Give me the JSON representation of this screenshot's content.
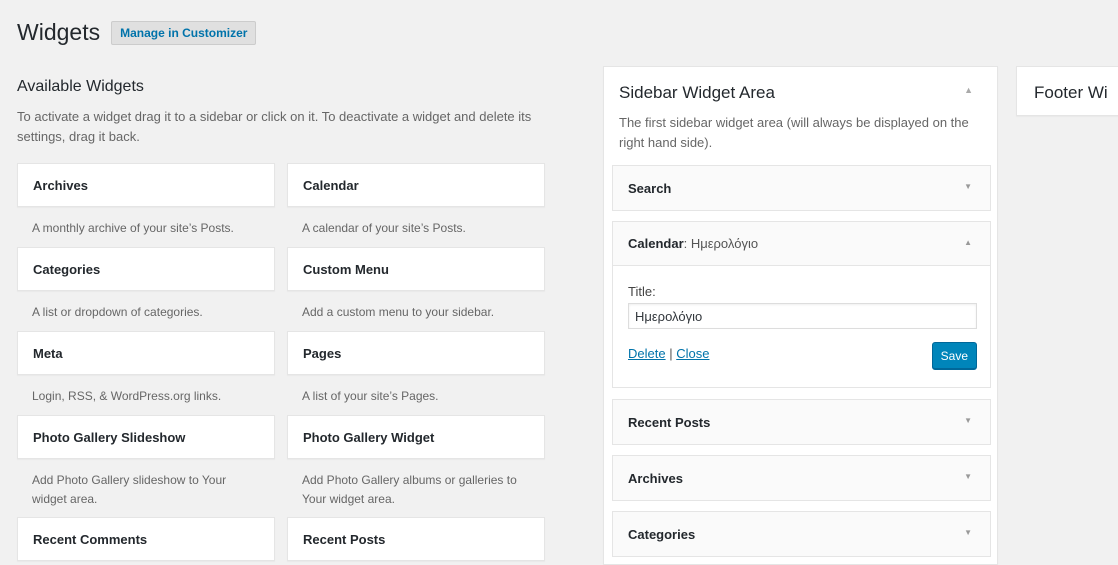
{
  "header": {
    "title": "Widgets",
    "customizer_label": "Manage in Customizer"
  },
  "available": {
    "heading": "Available Widgets",
    "description": "To activate a widget drag it to a sidebar or click on it. To deactivate a widget and delete its settings, drag it back.",
    "widgets": [
      {
        "title": "Archives",
        "desc": "A monthly archive of your site’s Posts."
      },
      {
        "title": "Calendar",
        "desc": "A calendar of your site’s Posts."
      },
      {
        "title": "Categories",
        "desc": "A list or dropdown of categories."
      },
      {
        "title": "Custom Menu",
        "desc": "Add a custom menu to your sidebar."
      },
      {
        "title": "Meta",
        "desc": "Login, RSS, & WordPress.org links."
      },
      {
        "title": "Pages",
        "desc": "A list of your site’s Pages."
      },
      {
        "title": "Photo Gallery Slideshow",
        "desc": "Add Photo Gallery slideshow to Your widget area."
      },
      {
        "title": "Photo Gallery Widget",
        "desc": "Add Photo Gallery albums or galleries to Your widget area."
      },
      {
        "title": "Recent Comments",
        "desc": ""
      },
      {
        "title": "Recent Posts",
        "desc": ""
      }
    ]
  },
  "sidebar": {
    "heading": "Sidebar Widget Area",
    "description": "The first sidebar widget area (will always be displayed on the right hand side).",
    "toggle_icon": "arrow-up-icon",
    "widgets": {
      "search": {
        "title": "Search"
      },
      "calendar": {
        "title": "Calendar",
        "instance_title": ": Ημερολόγιο",
        "field_label": "Title:",
        "field_value": "Ημερολόγιο",
        "delete_label": "Delete",
        "separator": "|",
        "close_label": "Close",
        "save_label": "Save"
      },
      "recent_posts": {
        "title": "Recent Posts"
      },
      "archives": {
        "title": "Archives"
      },
      "categories": {
        "title": "Categories"
      }
    }
  },
  "footer_area": {
    "heading": "Footer Wi"
  },
  "colors": {
    "accent": "#0073aa",
    "primary_button": "#0085ba",
    "background": "#f1f1f1"
  }
}
